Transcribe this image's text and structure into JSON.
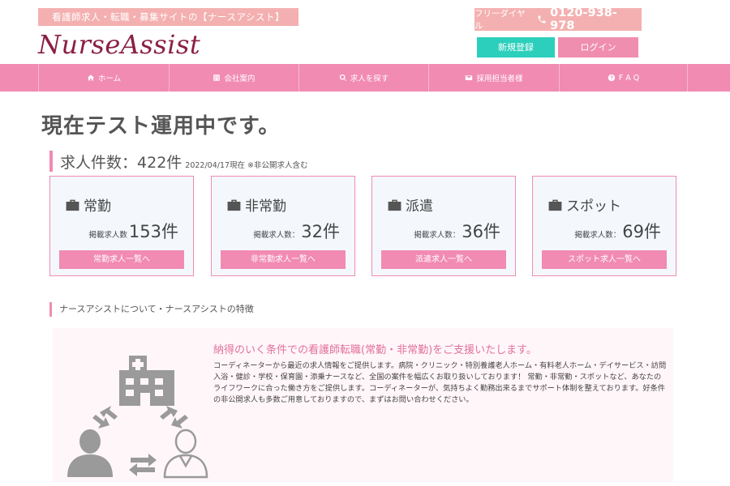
{
  "header": {
    "tagline": "看護師求人・転職・募集サイトの【ナースアシスト】",
    "logo": "NurseAssist",
    "phone_label": "フリーダイヤル",
    "phone_number": "0120-938-978",
    "register_label": "新規登録",
    "login_label": "ログイン"
  },
  "nav": [
    {
      "label": "ホーム",
      "icon": "home-icon"
    },
    {
      "label": "会社案内",
      "icon": "building-icon"
    },
    {
      "label": "求人を探す",
      "icon": "search-icon"
    },
    {
      "label": "採用担当者様",
      "icon": "mail-icon"
    },
    {
      "label": "F A Q",
      "icon": "question-icon"
    }
  ],
  "main": {
    "notice": "現在テスト運用中です。",
    "total_label": "求人件数：",
    "total_value": "422件",
    "total_note": "2022/04/17現在 ※非公開求人含む",
    "cards": [
      {
        "title": "常勤",
        "count_label": "掲載求人数",
        "count": "153件",
        "button": "常勤求人一覧へ"
      },
      {
        "title": "非常勤",
        "count_label": "掲載求人数：",
        "count": "32件",
        "button": "非常勤求人一覧へ"
      },
      {
        "title": "派遣",
        "count_label": "掲載求人数：",
        "count": "36件",
        "button": "派遣求人一覧へ"
      },
      {
        "title": "スポット",
        "count_label": "掲載求人数：",
        "count": "69件",
        "button": "スポット求人一覧へ"
      }
    ],
    "about_heading": "ナースアシストについて・ナースアシストの特徴",
    "feature_title": "納得のいく条件での看護師転職(常勤・非常勤)をご支援いたします。",
    "feature_text": "コーディネーターから最近の求人情報をご提供します。病院・クリニック・特別養護老人ホーム・有料老人ホーム・デイサービス・訪問入浴・健診・学校・保育園・添乗ナースなど、全国の案件を幅広くお取り扱いしております！ 常勤・非常勤・スポットなど、あなたのライフワークに合った働き方をご提供します。コーディネーターが、気持ちよく勤務出来るまでサポート体制を整えております。好条件の非公開求人も多数ご用意しておりますので、まずはお問い合わせください。"
  },
  "colors": {
    "pink": "#f18bb2",
    "light_pink": "#f4b0b0",
    "teal": "#2ccfbb",
    "logo": "#8b1f45"
  }
}
